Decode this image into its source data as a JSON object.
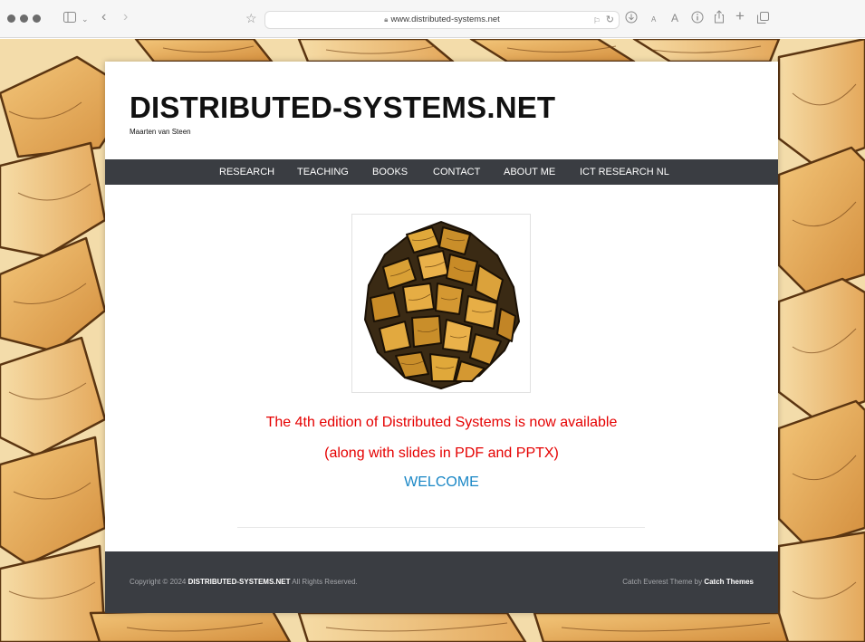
{
  "browser": {
    "url": "www.distributed-systems.net",
    "lock_icon": "lock-icon",
    "bookmark_icon": "star-icon",
    "text_small": "A",
    "text_large": "A"
  },
  "site": {
    "title": "DISTRIBUTED-SYSTEMS.NET",
    "tagline": "Maarten van Steen"
  },
  "nav": {
    "items": [
      {
        "label": "RESEARCH"
      },
      {
        "label": "TEACHING"
      },
      {
        "label": "BOOKS"
      },
      {
        "label": "CONTACT"
      },
      {
        "label": "ABOUT ME"
      },
      {
        "label": "ICT RESEARCH NL"
      }
    ]
  },
  "main": {
    "notice_line1": "The 4th edition of Distributed Systems is now available",
    "notice_line2": "(along with slides in PDF and PPTX)",
    "welcome": "WELCOME"
  },
  "footer": {
    "copyright_prefix": "Copyright © 2024",
    "copyright_site": "DISTRIBUTED-SYSTEMS.NET",
    "copyright_suffix": "All Rights Reserved.",
    "theme_prefix": "Catch Everest Theme by",
    "theme_author": "Catch Themes"
  },
  "colors": {
    "nav_bg": "#3a3d42",
    "notice": "#e50000",
    "welcome": "#1a87c6",
    "wood": "#e8b565"
  }
}
